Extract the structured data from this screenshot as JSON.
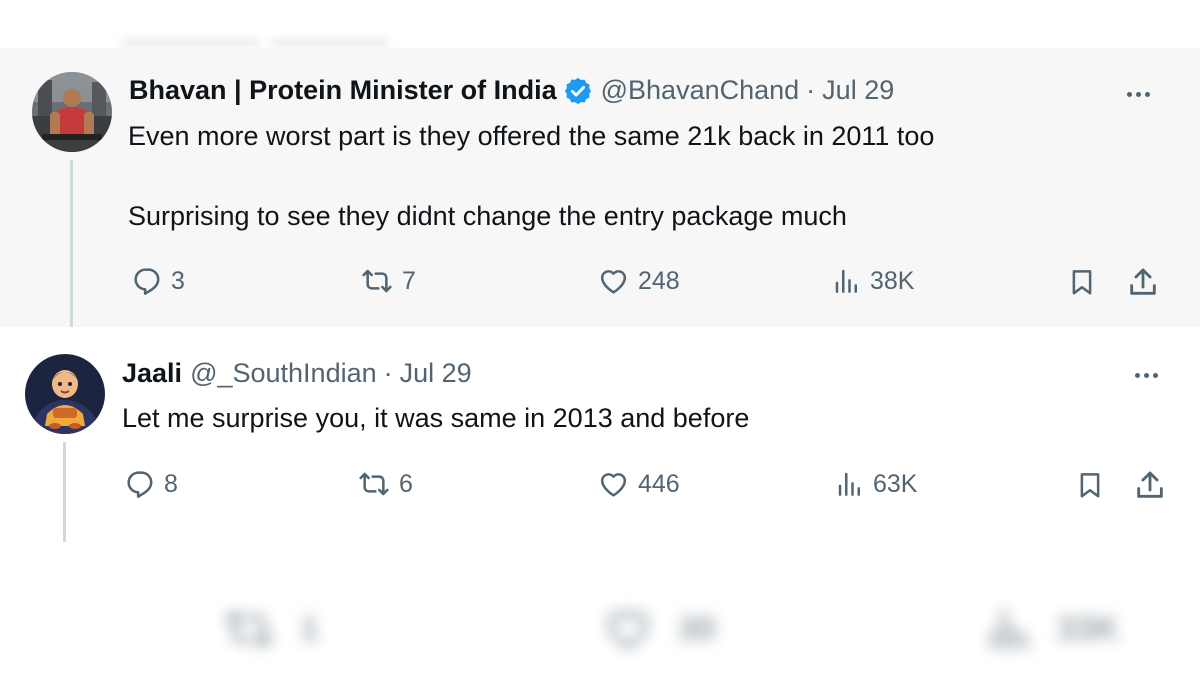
{
  "tweets": [
    {
      "author_name": "Bhavan | Protein Minister of India",
      "verified": true,
      "handle": "@BhavanChand",
      "separator": "·",
      "date": "Jul 29",
      "lines": [
        "Even more worst part is they offered the same 21k back in 2011 too",
        "Surprising to see they didnt change the entry package much"
      ],
      "replies": "3",
      "reposts": "7",
      "likes": "248",
      "views": "38K"
    },
    {
      "author_name": "Jaali",
      "verified": false,
      "handle": "@_SouthIndian",
      "separator": "·",
      "date": "Jul 29",
      "lines": [
        "Let me surprise you, it was same in 2013 and before"
      ],
      "replies": "8",
      "reposts": "6",
      "likes": "446",
      "views": "63K"
    }
  ],
  "background_tweet_stats": {
    "reposts": "1",
    "likes": "30",
    "views": "33K"
  },
  "colors": {
    "text": "#0f1419",
    "muted": "#536471",
    "verified_blue": "#1d9bf0",
    "thread_line": "#cfd9de"
  },
  "icons": [
    "reply-icon",
    "repost-icon",
    "like-icon",
    "views-icon",
    "bookmark-icon",
    "share-icon",
    "more-icon",
    "verified-icon"
  ]
}
